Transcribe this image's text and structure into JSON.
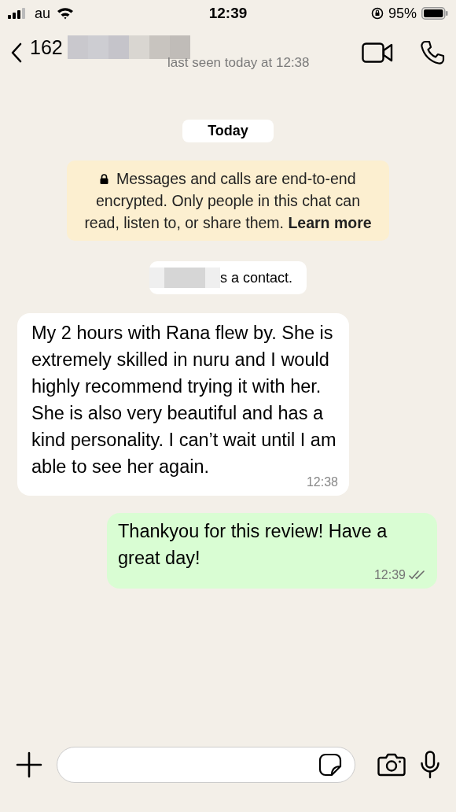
{
  "status_bar": {
    "carrier": "au",
    "time": "12:39",
    "battery": "95%"
  },
  "header": {
    "name": "162",
    "last_seen": "last seen today at 12:38"
  },
  "date_label": "Today",
  "encryption_notice": {
    "text": "Messages and calls are end-to-end encrypted. Only people in this chat can read, listen to, or share them. ",
    "link": "Learn more"
  },
  "system_message": "s a contact.",
  "messages": [
    {
      "kind": "incoming",
      "text": "My 2 hours with Rana flew by. She is extremely skilled in nuru and I would highly recommend trying it with her. She is also very beautiful and has a kind personality. I can’t wait until I am able to see her again.",
      "time": "12:38"
    },
    {
      "kind": "outgoing",
      "text": "Thankyou for this review! Have a great day!",
      "time": "12:39",
      "read": false
    }
  ]
}
